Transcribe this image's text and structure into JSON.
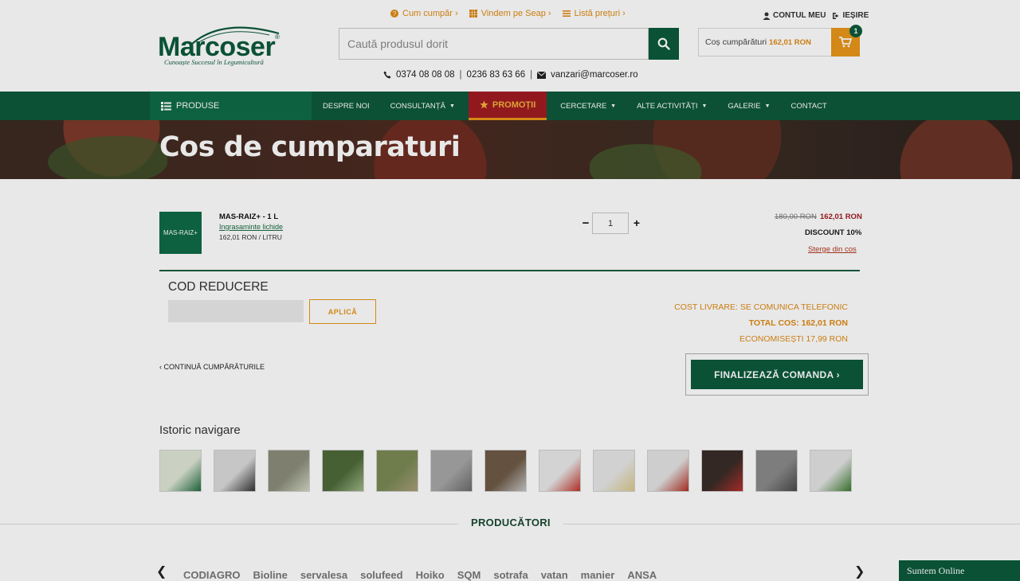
{
  "brand": {
    "name": "Marcoser",
    "tagline": "Cunoaște Succesul în Legumicultură",
    "reg": "®"
  },
  "toplinks": [
    {
      "label": "Cum cumpăr ›",
      "icon": "question-icon"
    },
    {
      "label": "Vindem pe Seap ›",
      "icon": "grid-icon"
    },
    {
      "label": "Listă prețuri ›",
      "icon": "list-icon"
    }
  ],
  "search": {
    "placeholder": "Caută produsul dorit"
  },
  "account": {
    "my_account": "CONTUL MEU",
    "logout": "IEȘIRE"
  },
  "cart": {
    "label": "Coș cumpărături",
    "total": "162,01 RON",
    "count": "1"
  },
  "contacts": {
    "phone1": "0374 08 08 08",
    "sep": "|",
    "phone2": "0236 83 63 66",
    "email": "vanzari@marcoser.ro"
  },
  "nav": {
    "products": "PRODUSE",
    "items": [
      {
        "label": "DESPRE NOI",
        "dropdown": false
      },
      {
        "label": "CONSULTANȚĂ",
        "dropdown": true
      },
      {
        "label": "PROMOȚII",
        "promo": true
      },
      {
        "label": "CERCETARE",
        "dropdown": true
      },
      {
        "label": "ALTE ACTIVITĂȚI",
        "dropdown": true
      },
      {
        "label": "GALERIE",
        "dropdown": true
      },
      {
        "label": "CONTACT",
        "dropdown": false
      }
    ]
  },
  "banner": {
    "title": "Cos de cumparaturi"
  },
  "product": {
    "thumb_text": "MAS-RAIZ+",
    "name": "MAS-RAIZ+ - 1 L",
    "category": "Ingrasaminte lichide",
    "unit_price": "162,01 RON / LITRU",
    "quantity": "1",
    "price_old": "180,00 RON",
    "price_new": "162,01 RON",
    "discount": "DISCOUNT 10%",
    "remove": "Sterge din cos"
  },
  "coupon": {
    "title": "COD REDUCERE",
    "apply": "APLICĂ",
    "value": ""
  },
  "summary": {
    "delivery": "COST LIVRARE: SE COMUNICA TELEFONIC",
    "total": "TOTAL COS: 162,01 RON",
    "savings": "ECONOMISEȘTI 17,99 RON"
  },
  "continue_label": "‹ CONTINUĂ CUMPĂRĂTURILE",
  "checkout_label": "FINALIZEAZĂ COMANDA ›",
  "history": {
    "title": "Istoric navigare",
    "thumbs": [
      {
        "bg": "#dfe6d6",
        "accent": "#1f6b3c"
      },
      {
        "bg": "#dadada",
        "accent": "#333333"
      },
      {
        "bg": "#8c8c7a",
        "accent": "#cfd8c2"
      },
      {
        "bg": "#4e6a3a",
        "accent": "#9fb887"
      },
      {
        "bg": "#7a8a55",
        "accent": "#a89e78"
      },
      {
        "bg": "#a6a6a6",
        "accent": "#6b6b6b"
      },
      {
        "bg": "#6e5a46",
        "accent": "#c7c7c7"
      },
      {
        "bg": "#e8e8e8",
        "accent": "#c0332a"
      },
      {
        "bg": "#e6e6e6",
        "accent": "#d9c88a"
      },
      {
        "bg": "#e3e3e3",
        "accent": "#b03024"
      },
      {
        "bg": "#3a2d28",
        "accent": "#b5302a"
      },
      {
        "bg": "#8a8a8a",
        "accent": "#4a4a4a"
      },
      {
        "bg": "#e3e3e3",
        "accent": "#3a7a2e"
      }
    ]
  },
  "producers": {
    "title": "PRODUCĂTORI",
    "logos": [
      "CODIAGRO",
      "Bioline",
      "servalesa",
      "solufeed",
      "Hoiko",
      "SQM",
      "sotrafa",
      "vatan",
      "manier",
      "ANSA"
    ]
  },
  "chat": "Suntem Online"
}
